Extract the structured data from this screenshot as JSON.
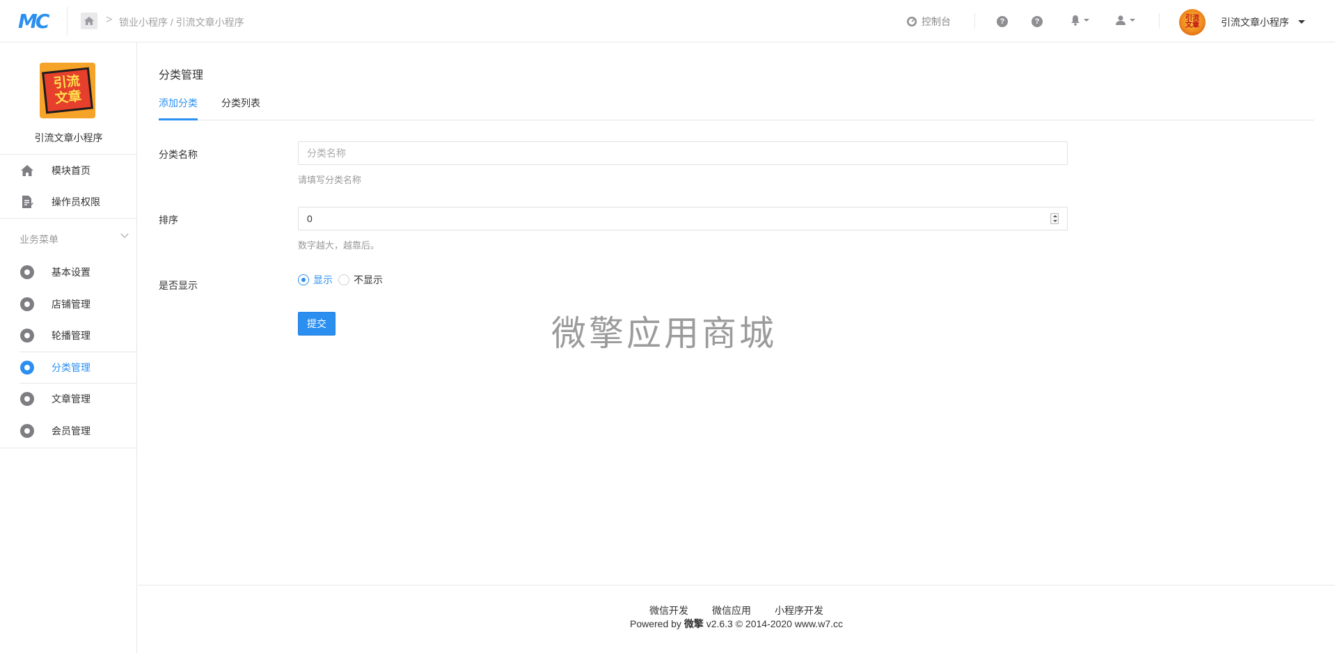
{
  "header": {
    "logo_text": "MC",
    "breadcrumb_sep": ">",
    "breadcrumb": "锁业小程序 / 引流文章小程序",
    "console_label": "控制台",
    "help_q": "?",
    "account_name": "引流文章小程序",
    "avatar_text": "引流文章"
  },
  "sidebar": {
    "app_logo_line1": "引流",
    "app_logo_line2": "文章",
    "app_name": "引流文章小程序",
    "top_items": [
      {
        "label": "模块首页"
      },
      {
        "label": "操作员权限"
      }
    ],
    "group_title": "业务菜单",
    "items": [
      {
        "label": "基本设置"
      },
      {
        "label": "店铺管理"
      },
      {
        "label": "轮播管理"
      },
      {
        "label": "分类管理"
      },
      {
        "label": "文章管理"
      },
      {
        "label": "会员管理"
      }
    ]
  },
  "main": {
    "title": "分类管理",
    "tabs": [
      {
        "label": "添加分类",
        "active": true
      },
      {
        "label": "分类列表",
        "active": false
      }
    ],
    "form": {
      "name_label": "分类名称",
      "name_placeholder": "分类名称",
      "name_value": "",
      "name_help": "请填写分类名称",
      "sort_label": "排序",
      "sort_value": "0",
      "sort_help": "数字越大，越靠后。",
      "show_label": "是否显示",
      "show_options": [
        {
          "label": "显示",
          "checked": true
        },
        {
          "label": "不显示",
          "checked": false
        }
      ],
      "submit_label": "提交"
    },
    "watermark": "微擎应用商城"
  },
  "footer": {
    "links": [
      "微信开发",
      "微信应用",
      "小程序开发"
    ],
    "copyright_prefix": "Powered by ",
    "copyright_brand": "微擎",
    "copyright_suffix": " v2.6.3 © 2014-2020 www.w7.cc"
  },
  "colors": {
    "accent": "#2b8ff0",
    "border": "#e7e7eb",
    "muted": "#999999"
  }
}
